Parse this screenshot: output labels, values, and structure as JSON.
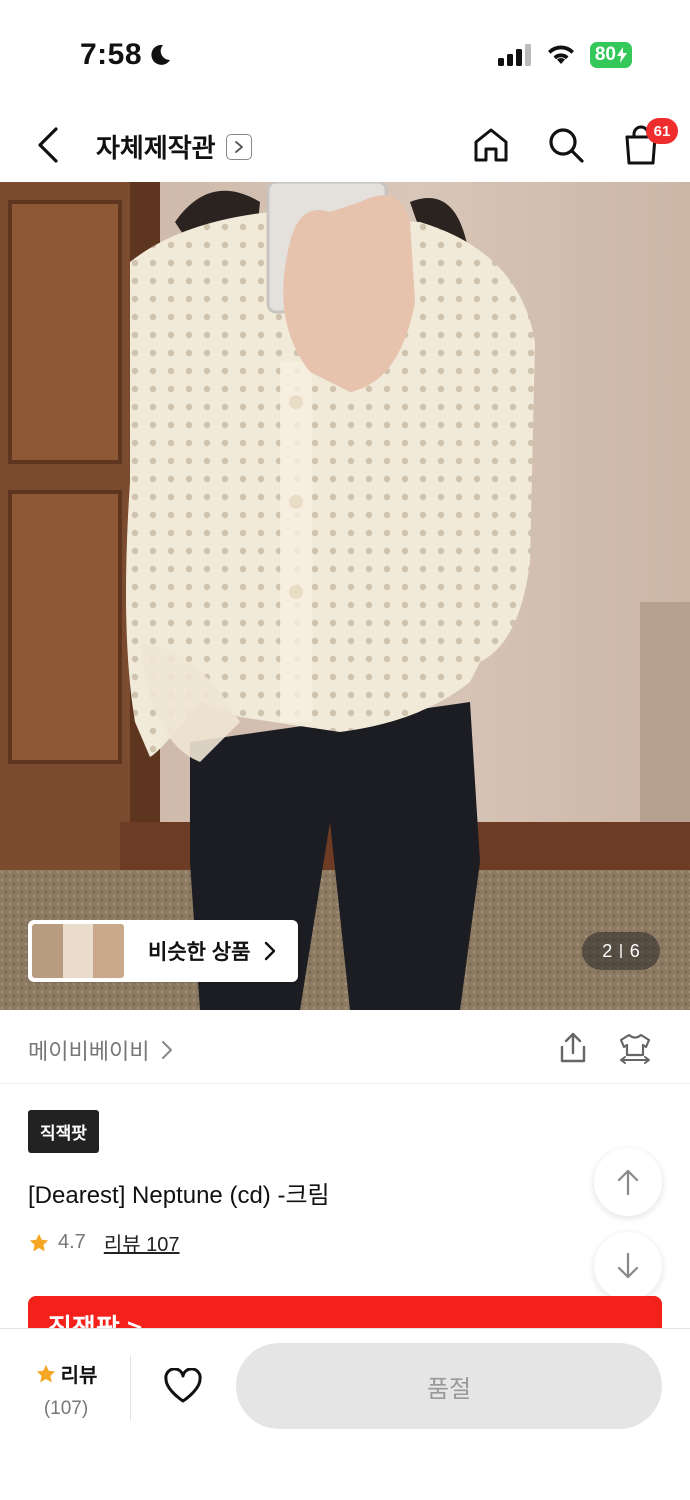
{
  "status_bar": {
    "time": "7:58",
    "battery": "80"
  },
  "nav": {
    "title": "자체제작관",
    "cart_count": "61"
  },
  "gallery": {
    "similar_label": "비슷한 상품",
    "current_page": "2",
    "total_pages": "6"
  },
  "brand": {
    "name": "메이비베이비"
  },
  "product": {
    "badge": "직잭팟",
    "name": "[Dearest] Neptune (cd) -크림",
    "rating": "4.7",
    "review_link": "리뷰 107"
  },
  "promo": {
    "label": "직잭팟 >"
  },
  "bottom_bar": {
    "review_label": "리뷰",
    "review_count": "(107)",
    "soldout_label": "품절"
  },
  "colors": {
    "accent_red": "#f4201a",
    "star": "#f5a623",
    "battery": "#34c759"
  }
}
